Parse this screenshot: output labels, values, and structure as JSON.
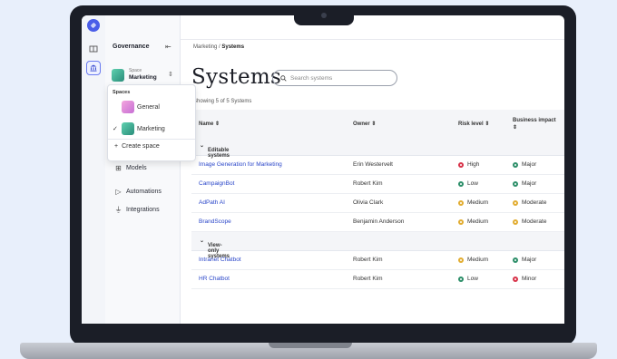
{
  "sidebar": {
    "title": "Governance",
    "collapse_icon": "collapse-left-icon",
    "space_kicker": "Space",
    "space_name": "Marketing",
    "nav": [
      {
        "label": "Models",
        "icon": "models-icon"
      },
      {
        "label": "Automations",
        "icon": "play-icon"
      },
      {
        "label": "Integrations",
        "icon": "plug-icon"
      }
    ]
  },
  "dropdown": {
    "heading": "Spaces",
    "items": [
      {
        "label": "General",
        "selected": false,
        "color": "#e38bd0"
      },
      {
        "label": "Marketing",
        "selected": true,
        "color": "#3fb79a"
      }
    ],
    "create_label": "Create space"
  },
  "breadcrumb": {
    "parent": "Marketing",
    "separator": " / ",
    "current": "Systems"
  },
  "page": {
    "title": "Systems",
    "search_placeholder": "Search systems",
    "showing": "Showing 5 of 5 Systems"
  },
  "table": {
    "columns": [
      "Name",
      "Owner",
      "Risk level",
      "Business impact"
    ],
    "groups": [
      {
        "label": "Editable systems",
        "rows": [
          {
            "name": "Image Generation for Marketing",
            "owner": "Erin Westervelt",
            "risk": "High",
            "impact": "Major"
          },
          {
            "name": "CampaignBot",
            "owner": "Robert Kim",
            "risk": "Low",
            "impact": "Major"
          },
          {
            "name": "AdPath AI",
            "owner": "Olivia Clark",
            "risk": "Medium",
            "impact": "Moderate"
          },
          {
            "name": "BrandScope",
            "owner": "Benjamin Anderson",
            "risk": "Medium",
            "impact": "Moderate"
          }
        ]
      },
      {
        "label": "View-only systems",
        "rows": [
          {
            "name": "Intranet Chatbot",
            "owner": "Robert Kim",
            "risk": "Medium",
            "impact": "Major"
          },
          {
            "name": "HR Chatbot",
            "owner": "Robert Kim",
            "risk": "Low",
            "impact": "Minor"
          }
        ]
      }
    ]
  },
  "colors": {
    "High": "#d8344a",
    "Low": "#2e8f6a",
    "Medium": "#e2ad32",
    "Major": "#2e8f6a",
    "Moderate": "#e2ad32",
    "Minor": "#d8344a",
    "accent": "#4a5de8"
  }
}
